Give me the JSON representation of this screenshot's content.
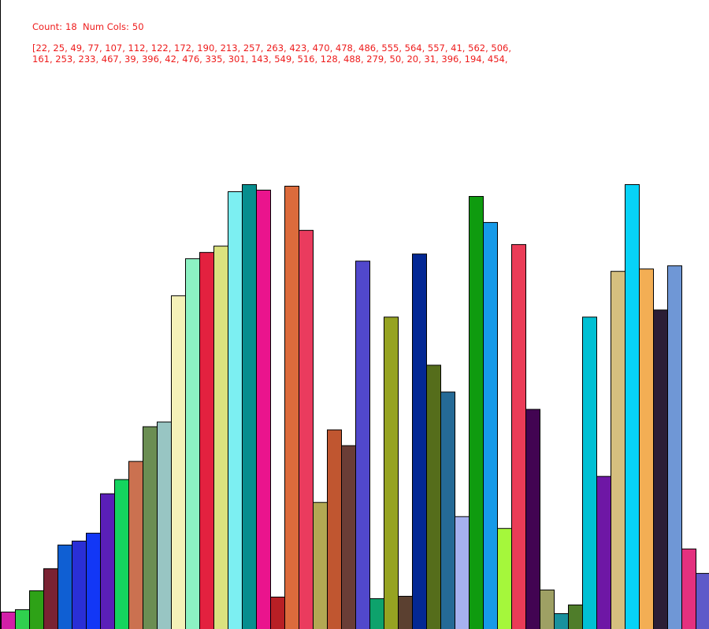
{
  "header": {
    "count_label": "Count:",
    "count_value": "18",
    "cols_label": "Num Cols:",
    "cols_value": "50",
    "array_line_1": "[22, 25, 49, 77, 107, 112, 122, 172, 190, 213, 257, 263, 423, 470, 478, 486, 555, 564, 557, 41, 562, 506,",
    "array_line_2": "161, 253, 233, 467, 39, 396, 42, 476, 335, 301, 143, 549, 516, 128, 488, 279, 50, 20, 31, 396, 194, 454,"
  },
  "chart_data": {
    "type": "bar",
    "title": "",
    "xlabel": "",
    "ylabel": "",
    "ylim": [
      0,
      564
    ],
    "values": [
      22,
      25,
      49,
      77,
      107,
      112,
      122,
      172,
      190,
      213,
      257,
      263,
      423,
      470,
      478,
      486,
      555,
      564,
      557,
      41,
      562,
      506,
      161,
      253,
      233,
      467,
      39,
      396,
      42,
      476,
      335,
      301,
      143,
      549,
      516,
      128,
      488,
      279,
      50,
      20,
      31,
      396,
      194,
      454,
      564,
      457,
      405,
      461,
      102,
      71
    ],
    "colors": [
      "#d21fa8",
      "#2fd04e",
      "#2ea217",
      "#7a2233",
      "#0f5fd3",
      "#2a2fd6",
      "#1237f6",
      "#5a1fb8",
      "#14d45e",
      "#cb7150",
      "#6b8e53",
      "#98c5c3",
      "#f4f1b8",
      "#8cf2c3",
      "#e3213f",
      "#dbe27f",
      "#7ceff2",
      "#068e8e",
      "#ea148d",
      "#b81f25",
      "#dc6b3c",
      "#ea3b5e",
      "#b3a853",
      "#c05630",
      "#6a3d36",
      "#5148cc",
      "#0ea26c",
      "#96a322",
      "#5b4030",
      "#032894",
      "#556d1b",
      "#256a96",
      "#a6b1ef",
      "#0f9b0f",
      "#169ae8",
      "#a5f73b",
      "#ea3c57",
      "#420452",
      "#9ea064",
      "#19919e",
      "#4f7d2a",
      "#00c0d3",
      "#6e17a5",
      "#d5bf7f",
      "#07d2f7",
      "#f3ae54",
      "#2b1e36",
      "#6f97d6",
      "#e3317f",
      "#5e5ac9"
    ]
  }
}
